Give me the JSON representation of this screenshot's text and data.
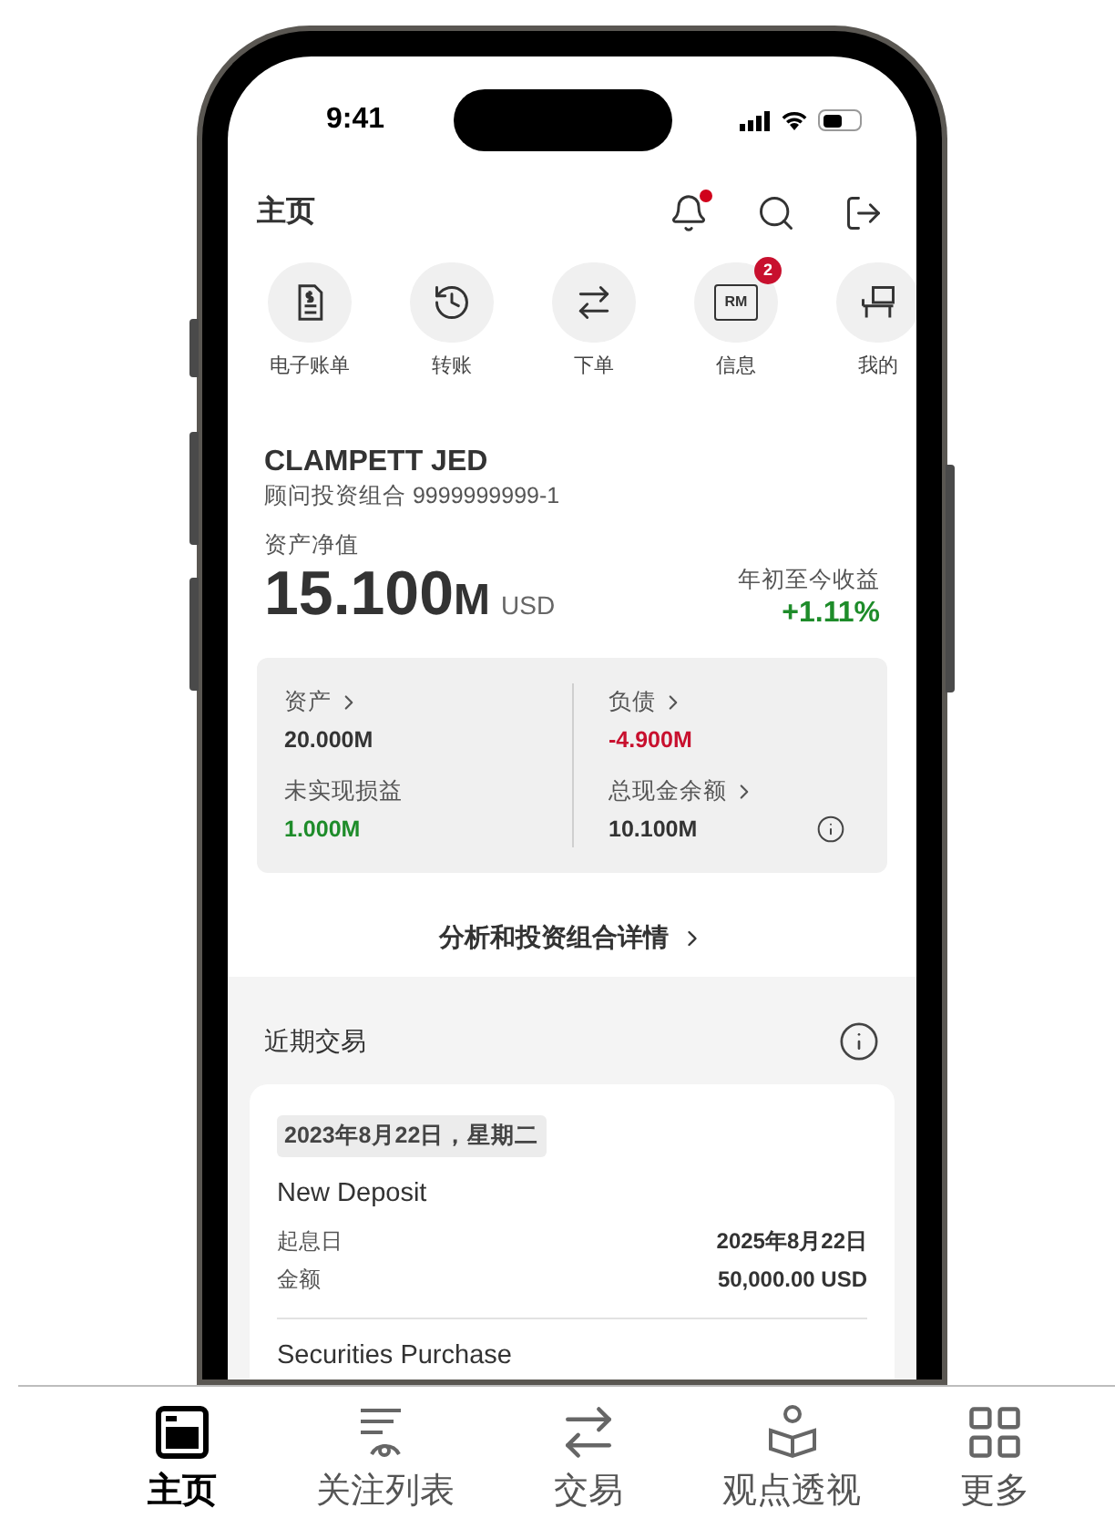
{
  "status_bar": {
    "time": "9:41"
  },
  "header": {
    "title": "主页",
    "has_notification": true
  },
  "quick_actions": [
    {
      "kind": "statement",
      "label": "电子账单"
    },
    {
      "kind": "history",
      "label": "转账"
    },
    {
      "kind": "transfer",
      "label": "下单"
    },
    {
      "kind": "message",
      "label": "信息",
      "icon_text": "RM",
      "badge": "2"
    },
    {
      "kind": "portfolio",
      "label": "我的"
    }
  ],
  "account": {
    "name": "CLAMPETT JED",
    "portfolio": "顾问投资组合 9999999999-1",
    "net_worth_label": "资产净值",
    "net_worth_value": "15.100",
    "net_worth_unit": "M",
    "currency": "USD",
    "ytd_label": "年初至今收益",
    "ytd_value": "+1.11%"
  },
  "summary": [
    {
      "label": "资产",
      "value": "20.000M",
      "link": true,
      "color": "#333333",
      "info": false
    },
    {
      "label": "负债",
      "value": "-4.900M",
      "link": true,
      "color": "#c8102e",
      "info": false
    },
    {
      "label": "未实现损益",
      "value": "1.000M",
      "link": false,
      "color": "#1e8c2a",
      "info": false
    },
    {
      "label": "总现金余额",
      "value": "10.100M",
      "link": true,
      "color": "#333333",
      "info": true
    }
  ],
  "details_link": "分析和投资组合详情",
  "recent": {
    "title": "近期交易",
    "date": "2023年8月22日，星期二",
    "transactions": [
      {
        "title": "New Deposit",
        "rows": [
          {
            "label": "起息日",
            "value": "2025年8月22日"
          },
          {
            "label": "金额",
            "value": "50,000.00 USD"
          }
        ]
      },
      {
        "title": "Securities Purchase"
      }
    ]
  },
  "tabs": [
    {
      "kind": "home",
      "label": "主页",
      "selected": true
    },
    {
      "kind": "watchlist",
      "label": "关注列表",
      "selected": false
    },
    {
      "kind": "trade",
      "label": "交易",
      "selected": false
    },
    {
      "kind": "insights",
      "label": "观点透视",
      "selected": false
    },
    {
      "kind": "more",
      "label": "更多",
      "selected": false
    }
  ]
}
